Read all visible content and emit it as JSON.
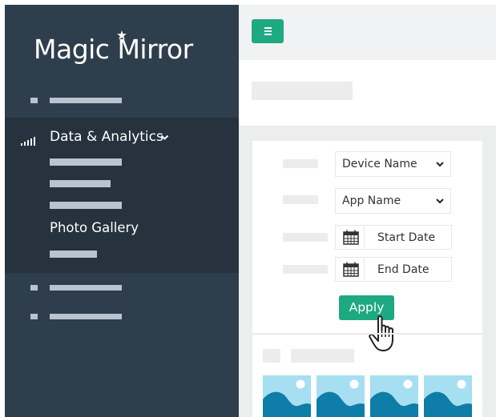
{
  "app": {
    "logo_text": "Magic Mirror"
  },
  "sidebar": {
    "section": {
      "title": "Data & Analytics",
      "items": [
        {
          "label": "Photo Gallery"
        }
      ]
    }
  },
  "toolbar": {
    "menu_icon": "menu-icon"
  },
  "filters": {
    "device": {
      "value": "Device Name"
    },
    "app": {
      "value": "App Name"
    },
    "start_date": {
      "value": "Start Date"
    },
    "end_date": {
      "value": "End Date"
    },
    "apply_label": "Apply"
  },
  "colors": {
    "sidebar": "#2f3e4c",
    "sidebar_active": "#26323e",
    "accent": "#1ea982",
    "image_sky": "#a6def2",
    "image_hill": "#0e7da8"
  }
}
